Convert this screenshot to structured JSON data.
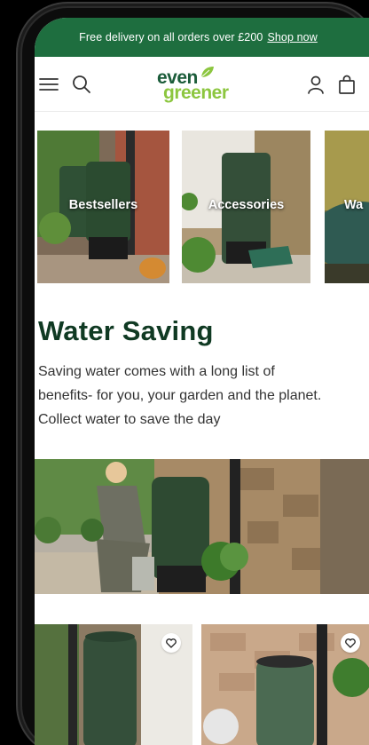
{
  "promo": {
    "text": "Free delivery on all orders over £200",
    "link": "Shop now"
  },
  "header": {
    "logo_top": "even",
    "logo_bottom": "greener",
    "icons": [
      "menu-icon",
      "search-icon",
      "account-icon",
      "bag-icon"
    ]
  },
  "categories": [
    {
      "label": "Bestsellers"
    },
    {
      "label": "Accessories"
    },
    {
      "label": "Wa"
    }
  ],
  "section": {
    "title": "Water Saving",
    "description": "Saving water comes with a long list of benefits- for you, your garden and the planet. Collect water to save the day"
  },
  "colors": {
    "promo_bg": "#1e6e3f",
    "title": "#103a23",
    "logo_dark": "#1b5c3a",
    "logo_light": "#8cc63f"
  }
}
